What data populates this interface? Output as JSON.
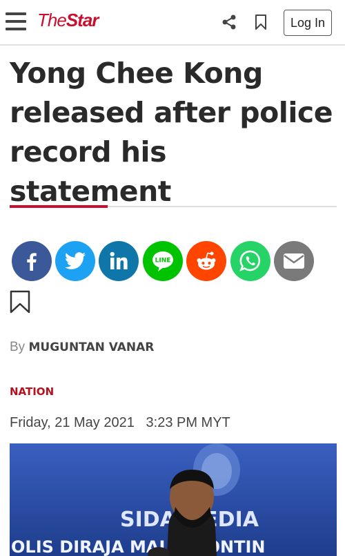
{
  "header": {
    "logo_the": "The",
    "logo_star": "Star",
    "login_label": "Log In"
  },
  "article": {
    "headline": "Yong Chee Kong released after police record his statement",
    "byline_prefix": "By",
    "author": "MUGUNTAN VANAR",
    "category": "NATION",
    "date": "Friday, 21 May 2021",
    "time": "3:23 PM MYT"
  },
  "photo": {
    "banner_line1": "SIDA     MEDIA",
    "banner_line2": "OLIS DIRAJA MAL     A KONTIN"
  },
  "social_share": [
    {
      "name": "facebook",
      "color": "#3b5998"
    },
    {
      "name": "twitter",
      "color": "#1da1f2"
    },
    {
      "name": "linkedin",
      "color": "#0e76a8"
    },
    {
      "name": "line",
      "color": "#00c300"
    },
    {
      "name": "reddit",
      "color": "#ff4500"
    },
    {
      "name": "whatsapp",
      "color": "#25d366"
    },
    {
      "name": "email",
      "color": "#7a7a7a"
    }
  ],
  "colors": {
    "brand_red": "#c8102e",
    "category_red": "#b4121f"
  }
}
